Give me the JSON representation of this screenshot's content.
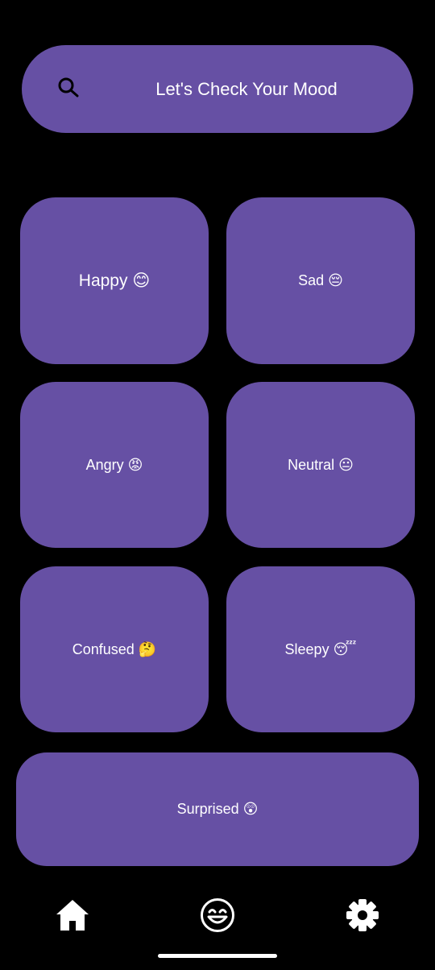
{
  "header": {
    "search_icon": "search-icon",
    "title": "Let's Check Your Mood"
  },
  "moods": [
    {
      "label": "Happy 😊",
      "name": "mood-card-happy"
    },
    {
      "label": "Sad 😔",
      "name": "mood-card-sad"
    },
    {
      "label": "Angry 😡",
      "name": "mood-card-angry"
    },
    {
      "label": "Neutral 😐",
      "name": "mood-card-neutral"
    },
    {
      "label": "Confused 🤔",
      "name": "mood-card-confused"
    },
    {
      "label": "Sleepy 😴",
      "name": "mood-card-sleepy"
    },
    {
      "label": "Surprised 😲",
      "name": "mood-card-surprised"
    }
  ],
  "bottom_nav": {
    "items": [
      {
        "icon": "home-icon"
      },
      {
        "icon": "smiley-icon"
      },
      {
        "icon": "gear-icon"
      }
    ]
  },
  "colors": {
    "background": "#000000",
    "card": "#6650a4",
    "text": "#ffffff"
  }
}
